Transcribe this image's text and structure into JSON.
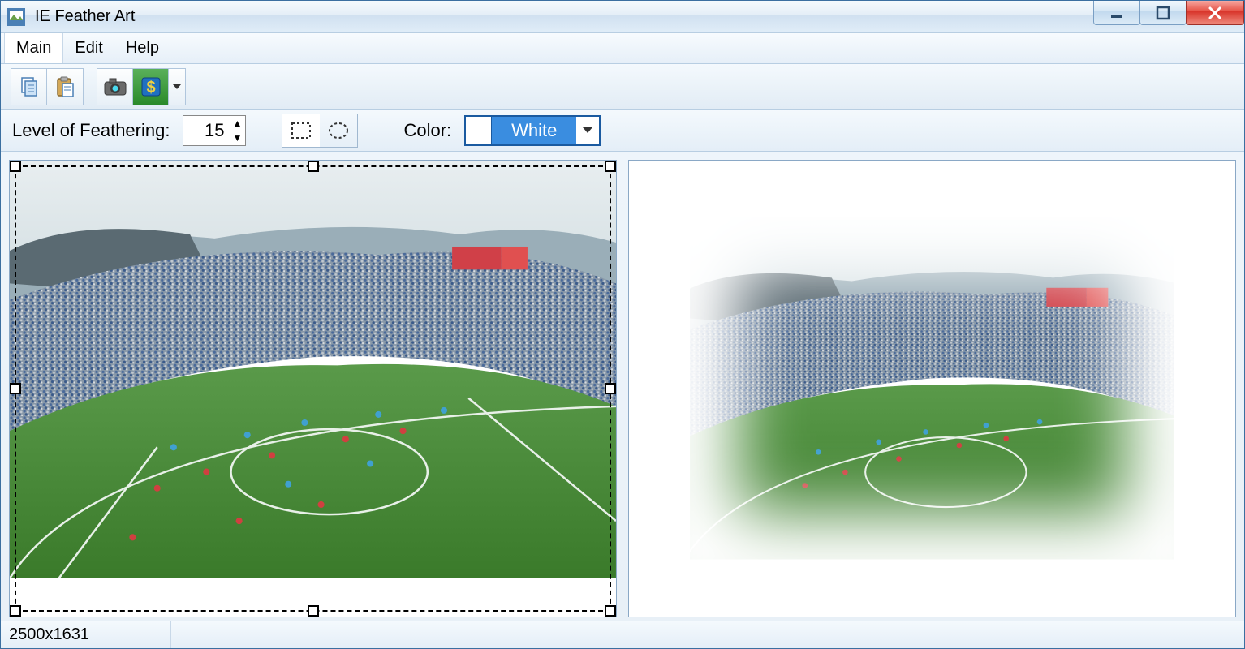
{
  "app": {
    "title": "IE Feather Art"
  },
  "menu": {
    "main": "Main",
    "edit": "Edit",
    "help": "Help"
  },
  "toolbar": {
    "feather_label": "Level of Feathering:",
    "feather_value": "15",
    "color_label": "Color:",
    "color_value": "White",
    "color_hex": "#ffffff"
  },
  "status": {
    "dimensions": "2500x1631"
  }
}
